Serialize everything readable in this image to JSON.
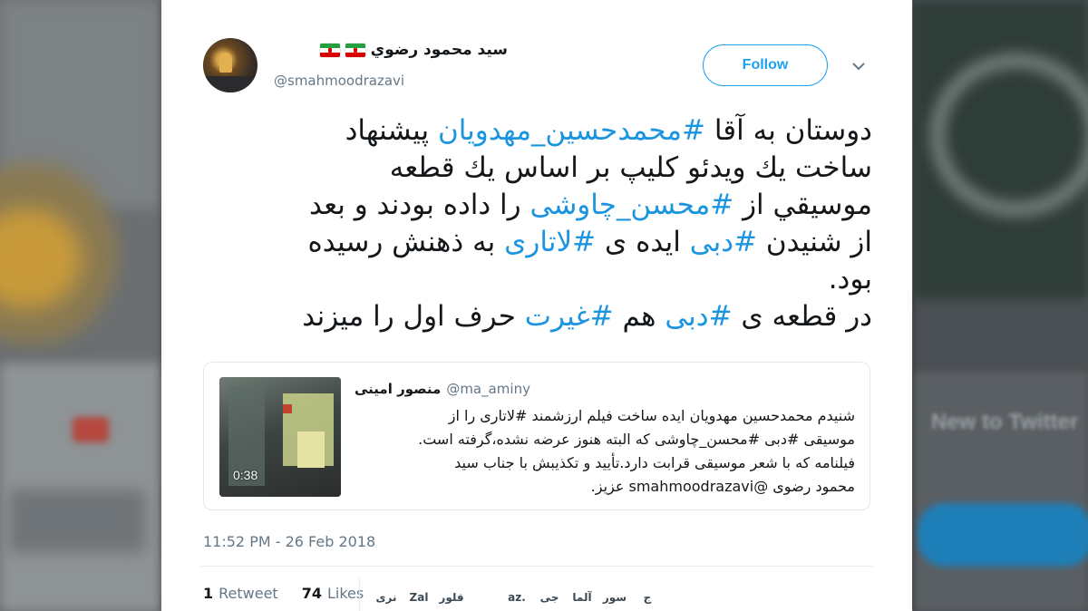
{
  "tweet": {
    "display_name": "سيد محمود رضوي",
    "handle": "@smahmoodrazavi",
    "follow_label": "Follow",
    "text_lines": [
      [
        {
          "t": "دوستان به آقا "
        },
        {
          "t": "#محمدحسين_مهدويان",
          "h": true
        },
        {
          "t": " پيشنهاد"
        }
      ],
      [
        {
          "t": "ساخت يك ويدئو كليپ بر اساس يك قطعه"
        }
      ],
      [
        {
          "t": "موسيقي از "
        },
        {
          "t": "#محسن_چاوشی",
          "h": true
        },
        {
          "t": " را داده بودند و بعد"
        }
      ],
      [
        {
          "t": "از شنيدن "
        },
        {
          "t": "#دبی",
          "h": true
        },
        {
          "t": " ايده ی "
        },
        {
          "t": "#لاتاری",
          "h": true
        },
        {
          "t": " به ذهنش رسيده"
        }
      ],
      [
        {
          "t": "بود."
        }
      ],
      [
        {
          "t": "در قطعه ی "
        },
        {
          "t": "#دبی",
          "h": true
        },
        {
          "t": " هم "
        },
        {
          "t": "#غيرت",
          "h": true
        },
        {
          "t": " حرف اول را ميزند"
        }
      ]
    ],
    "timestamp": "11:52 PM - 26 Feb 2018",
    "retweets_count": "1",
    "retweets_label": "Retweet",
    "likes_count": "74",
    "likes_label": "Likes",
    "likers": [
      "نری",
      "Zal",
      "قلور",
      "",
      "az.",
      "جی",
      "آلما",
      "سور",
      "ج"
    ]
  },
  "quoted": {
    "display_name": "منصور امينی",
    "handle": "@ma_aminy",
    "video_duration": "0:38",
    "text_lines": [
      "شنیدم محمدحسین مهدویان ایده ساخت فیلم ارزشمند #لاتاری را از",
      "موسیقی #دبی #محسن_چاوشی که البته هنوز عرضه نشده،گرفته است.",
      "فیلنامه که با شعر موسیقی قرابت دارد.تأیید و تکذیبش با جناب سید",
      "محمود رضوی @smahmoodrazavi عزیز."
    ]
  },
  "background": {
    "right_text": "New to Twitter"
  },
  "colors": {
    "accent": "#1da1f2",
    "hashtag": "#1b95e0",
    "text": "#14171a",
    "muted": "#657786"
  }
}
